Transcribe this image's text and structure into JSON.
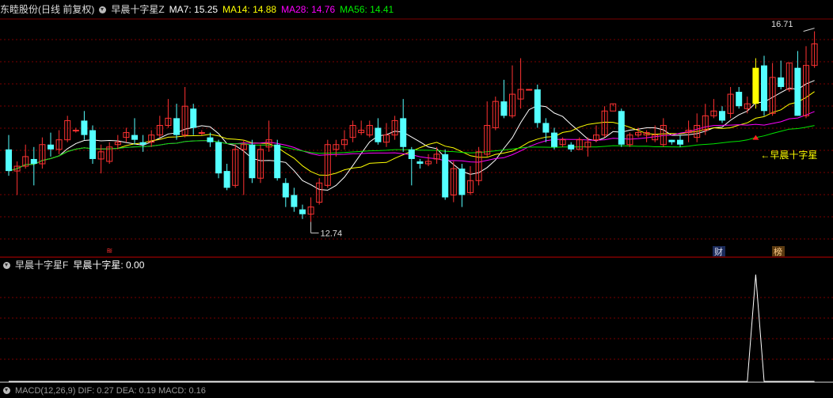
{
  "main_header": {
    "stock_title": "东睦股份(日线 前复权)",
    "indicator_name": "早晨十字星Z",
    "ma7": "MA7: 15.25",
    "ma14": "MA14: 14.88",
    "ma28": "MA28: 14.76",
    "ma56": "MA56: 14.41"
  },
  "sub_header": {
    "indicator_name": "早晨十字星F",
    "value_text": "早晨十字星: 0.00"
  },
  "bottom_header": {
    "text": "MACD(12,26,9) DIF: 0.27 DEA: 0.19 MACD: 0.16"
  },
  "annotations": {
    "high_label": "16.71",
    "low_label": "12.74",
    "signal_label": "早晨十字星",
    "marker_cai": "财",
    "marker_bang": "榜",
    "marker_left": "≋"
  },
  "colors": {
    "up": "#ff3232",
    "down": "#54ffff",
    "ma7": "#ffffff",
    "ma14": "#ffff00",
    "ma28": "#ff00ff",
    "ma56": "#00e600",
    "signal_bar": "#ffff00",
    "grid": "#7a0000",
    "divider": "#c00000"
  },
  "chart_data": {
    "type": "candlestick",
    "price_high_visible": 16.71,
    "price_low_visible": 12.74,
    "candles": [
      [
        14.25,
        13.8,
        14.55,
        13.7
      ],
      [
        13.8,
        13.9,
        14.0,
        13.3
      ],
      [
        13.9,
        14.1,
        14.35,
        13.85
      ],
      [
        14.05,
        13.95,
        14.3,
        13.5
      ],
      [
        13.95,
        14.35,
        14.5,
        13.85
      ],
      [
        14.35,
        14.25,
        14.6,
        14.1
      ],
      [
        14.25,
        14.45,
        14.65,
        14.15
      ],
      [
        14.45,
        14.85,
        14.95,
        14.4
      ],
      [
        14.65,
        14.65,
        14.7,
        14.6
      ],
      [
        14.85,
        14.55,
        15.05,
        14.45
      ],
      [
        14.65,
        14.05,
        14.75,
        13.95
      ],
      [
        14.05,
        14.2,
        14.35,
        13.75
      ],
      [
        14.0,
        14.3,
        14.4,
        13.95
      ],
      [
        14.35,
        14.4,
        14.55,
        14.25
      ],
      [
        14.5,
        14.6,
        14.7,
        14.4
      ],
      [
        14.55,
        14.45,
        14.9,
        14.35
      ],
      [
        14.4,
        14.35,
        14.55,
        14.2
      ],
      [
        14.4,
        14.55,
        14.65,
        14.3
      ],
      [
        14.55,
        14.75,
        14.95,
        14.5
      ],
      [
        14.75,
        14.9,
        15.3,
        14.7
      ],
      [
        14.9,
        14.55,
        15.2,
        14.45
      ],
      [
        14.55,
        15.15,
        15.55,
        14.5
      ],
      [
        15.1,
        14.7,
        15.2,
        14.55
      ],
      [
        14.6,
        14.6,
        14.65,
        14.55
      ],
      [
        14.5,
        14.4,
        14.6,
        14.3
      ],
      [
        14.4,
        13.75,
        14.45,
        13.65
      ],
      [
        13.8,
        13.45,
        13.95,
        13.4
      ],
      [
        13.5,
        14.25,
        14.35,
        13.45
      ],
      [
        14.25,
        14.35,
        14.45,
        13.3
      ],
      [
        14.35,
        13.65,
        14.45,
        13.55
      ],
      [
        13.65,
        14.25,
        14.35,
        13.55
      ],
      [
        14.3,
        14.45,
        14.85,
        14.2
      ],
      [
        14.35,
        13.65,
        14.45,
        13.6
      ],
      [
        13.55,
        13.25,
        13.65,
        13.05
      ],
      [
        13.3,
        13.05,
        13.45,
        12.95
      ],
      [
        13.0,
        12.9,
        13.1,
        12.8
      ],
      [
        12.9,
        13.05,
        13.25,
        12.74
      ],
      [
        13.15,
        13.55,
        13.65,
        13.1
      ],
      [
        13.5,
        14.35,
        14.45,
        13.45
      ],
      [
        14.25,
        14.35,
        14.45,
        14.1
      ],
      [
        14.35,
        14.45,
        14.65,
        14.25
      ],
      [
        14.5,
        14.75,
        14.85,
        14.4
      ],
      [
        14.6,
        14.65,
        14.85,
        14.55
      ],
      [
        14.55,
        14.75,
        14.85,
        14.5
      ],
      [
        14.7,
        14.4,
        14.9,
        14.35
      ],
      [
        14.4,
        14.55,
        14.8,
        14.3
      ],
      [
        14.55,
        14.85,
        14.95,
        14.45
      ],
      [
        14.9,
        14.3,
        15.3,
        14.2
      ],
      [
        14.25,
        14.05,
        14.3,
        13.5
      ],
      [
        14.0,
        13.95,
        14.05,
        13.85
      ],
      [
        13.95,
        14.0,
        14.15,
        13.9
      ],
      [
        14.05,
        14.15,
        14.3,
        13.95
      ],
      [
        14.15,
        13.25,
        14.25,
        13.2
      ],
      [
        13.3,
        13.85,
        14.0,
        13.15
      ],
      [
        13.85,
        13.3,
        13.95,
        13.05
      ],
      [
        13.35,
        13.6,
        13.9,
        13.3
      ],
      [
        13.6,
        14.2,
        14.3,
        13.5
      ],
      [
        14.15,
        14.75,
        15.25,
        14.1
      ],
      [
        14.7,
        15.25,
        15.35,
        14.65
      ],
      [
        15.25,
        14.95,
        15.7,
        14.9
      ],
      [
        14.95,
        15.4,
        16.0,
        14.9
      ],
      [
        15.3,
        15.5,
        16.15,
        15.1
      ],
      [
        15.5,
        15.5,
        15.5,
        15.5
      ],
      [
        15.5,
        14.8,
        15.6,
        14.7
      ],
      [
        14.8,
        14.6,
        14.9,
        14.4
      ],
      [
        14.6,
        14.3,
        14.7,
        14.25
      ],
      [
        14.35,
        14.45,
        14.5,
        14.3
      ],
      [
        14.35,
        14.25,
        14.4,
        14.2
      ],
      [
        14.25,
        14.45,
        14.5,
        14.25
      ],
      [
        14.3,
        14.4,
        14.5,
        14.1
      ],
      [
        14.45,
        14.55,
        14.75,
        14.4
      ],
      [
        14.55,
        15.05,
        15.15,
        14.5
      ],
      [
        15.05,
        15.2,
        15.2,
        15.15
      ],
      [
        15.05,
        14.35,
        15.1,
        14.3
      ],
      [
        14.35,
        14.55,
        14.6,
        14.3
      ],
      [
        14.55,
        14.6,
        14.7,
        14.5
      ],
      [
        14.55,
        14.6,
        14.65,
        14.4
      ],
      [
        14.45,
        14.55,
        14.75,
        14.4
      ],
      [
        14.35,
        14.75,
        14.9,
        14.3
      ],
      [
        14.45,
        14.4,
        14.45,
        14.35
      ],
      [
        14.45,
        14.35,
        14.55,
        14.3
      ],
      [
        14.6,
        14.65,
        14.85,
        14.4
      ],
      [
        14.5,
        14.75,
        15.0,
        14.4
      ],
      [
        14.65,
        14.95,
        15.2,
        14.55
      ],
      [
        14.95,
        15.05,
        15.3,
        14.9
      ],
      [
        15.05,
        14.85,
        15.15,
        14.8
      ],
      [
        15.0,
        15.4,
        15.55,
        14.9
      ],
      [
        15.45,
        15.15,
        15.55,
        15.1
      ],
      [
        15.1,
        15.2,
        15.35,
        15.0
      ],
      [
        15.2,
        15.95,
        16.15,
        15.1
      ],
      [
        16.0,
        15.05,
        16.2,
        14.95
      ],
      [
        15.0,
        15.75,
        16.05,
        14.95
      ],
      [
        15.75,
        15.55,
        16.1,
        15.5
      ],
      [
        15.5,
        16.05,
        16.05,
        15.45
      ],
      [
        15.95,
        14.95,
        16.3,
        14.95
      ],
      [
        14.95,
        16.0,
        16.4,
        14.9
      ],
      [
        16.0,
        16.45,
        16.71,
        15.95
      ]
    ],
    "indicator": {
      "name": "早晨十字星",
      "current_value": 0,
      "signal_index": 89,
      "signal_value": 1
    }
  }
}
